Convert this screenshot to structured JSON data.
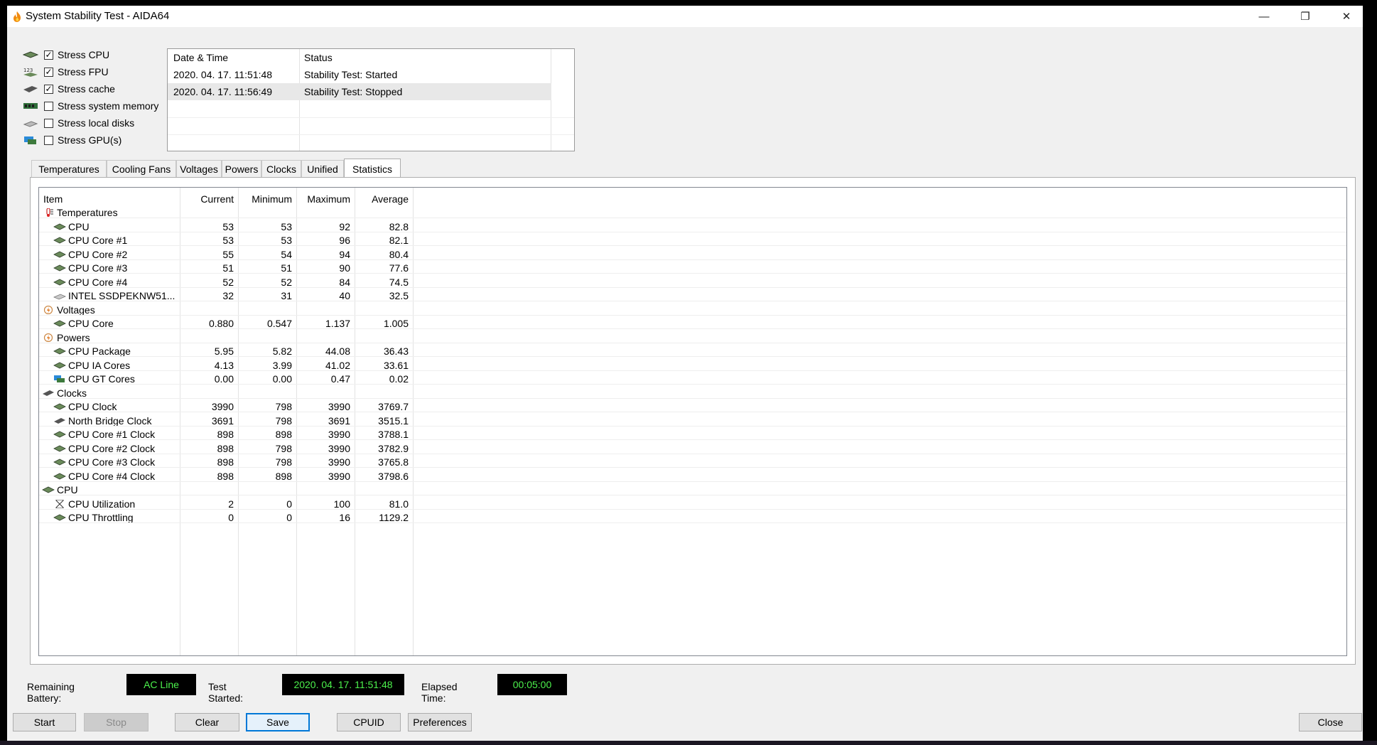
{
  "window": {
    "title": "System Stability Test - AIDA64",
    "controls": {
      "minimize": "—",
      "restore": "❐",
      "close": "✕"
    }
  },
  "stress_options": [
    {
      "label": "Stress CPU",
      "checked": true,
      "icon": "cpu-chip-icon"
    },
    {
      "label": "Stress FPU",
      "checked": true,
      "icon": "fpu-123-icon"
    },
    {
      "label": "Stress cache",
      "checked": true,
      "icon": "cache-chip-icon"
    },
    {
      "label": "Stress system memory",
      "checked": false,
      "icon": "memory-module-icon"
    },
    {
      "label": "Stress local disks",
      "checked": false,
      "icon": "disk-drive-icon"
    },
    {
      "label": "Stress GPU(s)",
      "checked": false,
      "icon": "gpu-card-icon"
    }
  ],
  "log": {
    "headers": {
      "datetime": "Date & Time",
      "status": "Status"
    },
    "rows": [
      {
        "datetime": "2020. 04. 17. 11:51:48",
        "status": "Stability Test: Started"
      },
      {
        "datetime": "2020. 04. 17. 11:56:49",
        "status": "Stability Test: Stopped"
      }
    ]
  },
  "tabs": [
    "Temperatures",
    "Cooling Fans",
    "Voltages",
    "Powers",
    "Clocks",
    "Unified",
    "Statistics"
  ],
  "active_tab": "Statistics",
  "stats": {
    "headers": {
      "item": "Item",
      "current": "Current",
      "minimum": "Minimum",
      "maximum": "Maximum",
      "average": "Average"
    },
    "rows": [
      {
        "type": "group",
        "name": "Temperatures",
        "icon": "thermometer-icon"
      },
      {
        "type": "item",
        "name": "CPU",
        "icon": "cpu-chip-icon",
        "current": "53",
        "minimum": "53",
        "maximum": "92",
        "average": "82.8"
      },
      {
        "type": "item",
        "name": "CPU Core #1",
        "icon": "cpu-chip-icon",
        "current": "53",
        "minimum": "53",
        "maximum": "96",
        "average": "82.1"
      },
      {
        "type": "item",
        "name": "CPU Core #2",
        "icon": "cpu-chip-icon",
        "current": "55",
        "minimum": "54",
        "maximum": "94",
        "average": "80.4"
      },
      {
        "type": "item",
        "name": "CPU Core #3",
        "icon": "cpu-chip-icon",
        "current": "51",
        "minimum": "51",
        "maximum": "90",
        "average": "77.6"
      },
      {
        "type": "item",
        "name": "CPU Core #4",
        "icon": "cpu-chip-icon",
        "current": "52",
        "minimum": "52",
        "maximum": "84",
        "average": "74.5"
      },
      {
        "type": "item",
        "name": "INTEL SSDPEKNW51...",
        "icon": "disk-drive-icon",
        "current": "32",
        "minimum": "31",
        "maximum": "40",
        "average": "32.5"
      },
      {
        "type": "group",
        "name": "Voltages",
        "icon": "voltage-icon"
      },
      {
        "type": "item",
        "name": "CPU Core",
        "icon": "cpu-chip-icon",
        "current": "0.880",
        "minimum": "0.547",
        "maximum": "1.137",
        "average": "1.005"
      },
      {
        "type": "group",
        "name": "Powers",
        "icon": "power-icon"
      },
      {
        "type": "item",
        "name": "CPU Package",
        "icon": "cpu-chip-icon",
        "current": "5.95",
        "minimum": "5.82",
        "maximum": "44.08",
        "average": "36.43"
      },
      {
        "type": "item",
        "name": "CPU IA Cores",
        "icon": "cpu-chip-icon",
        "current": "4.13",
        "minimum": "3.99",
        "maximum": "41.02",
        "average": "33.61"
      },
      {
        "type": "item",
        "name": "CPU GT Cores",
        "icon": "gpu-card-icon",
        "current": "0.00",
        "minimum": "0.00",
        "maximum": "0.47",
        "average": "0.02"
      },
      {
        "type": "group",
        "name": "Clocks",
        "icon": "cache-chip-icon"
      },
      {
        "type": "item",
        "name": "CPU Clock",
        "icon": "cpu-chip-icon",
        "current": "3990",
        "minimum": "798",
        "maximum": "3990",
        "average": "3769.7"
      },
      {
        "type": "item",
        "name": "North Bridge Clock",
        "icon": "cache-chip-icon",
        "current": "3691",
        "minimum": "798",
        "maximum": "3691",
        "average": "3515.1"
      },
      {
        "type": "item",
        "name": "CPU Core #1 Clock",
        "icon": "cpu-chip-icon",
        "current": "898",
        "minimum": "898",
        "maximum": "3990",
        "average": "3788.1"
      },
      {
        "type": "item",
        "name": "CPU Core #2 Clock",
        "icon": "cpu-chip-icon",
        "current": "898",
        "minimum": "798",
        "maximum": "3990",
        "average": "3782.9"
      },
      {
        "type": "item",
        "name": "CPU Core #3 Clock",
        "icon": "cpu-chip-icon",
        "current": "898",
        "minimum": "798",
        "maximum": "3990",
        "average": "3765.8"
      },
      {
        "type": "item",
        "name": "CPU Core #4 Clock",
        "icon": "cpu-chip-icon",
        "current": "898",
        "minimum": "898",
        "maximum": "3990",
        "average": "3798.6"
      },
      {
        "type": "group",
        "name": "CPU",
        "icon": "cpu-chip-icon"
      },
      {
        "type": "item",
        "name": "CPU Utilization",
        "icon": "hourglass-icon",
        "current": "2",
        "minimum": "0",
        "maximum": "100",
        "average": "81.0"
      },
      {
        "type": "item",
        "name": "CPU Throttling",
        "icon": "cpu-chip-icon",
        "current": "0",
        "minimum": "0",
        "maximum": "16",
        "average": "1129.2"
      }
    ]
  },
  "status": {
    "battery_label": "Remaining Battery:",
    "battery_value": "AC Line",
    "started_label": "Test Started:",
    "started_value": "2020. 04. 17. 11:51:48",
    "elapsed_label": "Elapsed Time:",
    "elapsed_value": "00:05:00"
  },
  "buttons": {
    "start": "Start",
    "stop": "Stop",
    "clear": "Clear",
    "save": "Save",
    "cpuid": "CPUID",
    "preferences": "Preferences",
    "close": "Close"
  },
  "colors": {
    "status_text": "#4cf14c",
    "status_bg": "#000000",
    "focus_border": "#0078d7"
  }
}
